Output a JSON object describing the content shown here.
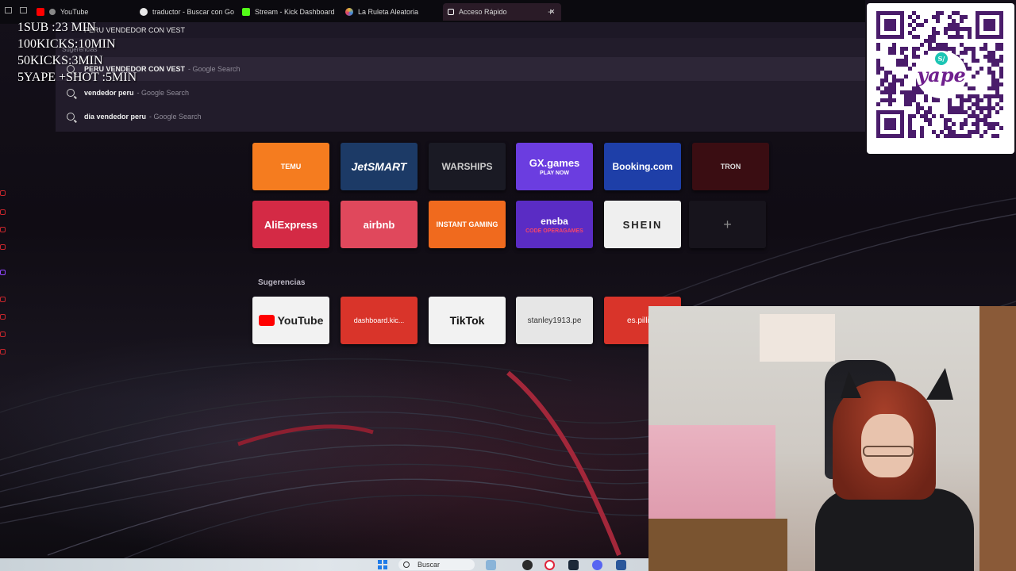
{
  "browser": {
    "tabs": [
      {
        "title": "YouTube",
        "icon": "youtube-icon",
        "color": "#ff0000"
      },
      {
        "title": "traductor - Buscar con Go",
        "icon": "google-icon",
        "color": "#e8e8e8"
      },
      {
        "title": "Stream - Kick Dashboard",
        "icon": "kick-icon",
        "color": "#53fc18"
      },
      {
        "title": "La Ruleta Aleatoria",
        "icon": "wheel-icon",
        "color": "#e0b83a"
      },
      {
        "title": "Acceso Rápido",
        "icon": "grid-icon",
        "color": "#ffffff"
      }
    ],
    "address_value": "PERU VENDEDOR CON VEST",
    "suggestions_heading": "Sugerencias",
    "suggestions": [
      {
        "text": "PERU VENDEDOR CON VEST",
        "engine": "- Google Search"
      },
      {
        "text": "vendedor peru",
        "engine": "- Google Search"
      },
      {
        "text": "dia vendedor peru",
        "engine": "- Google Search"
      }
    ]
  },
  "overlay": {
    "lines": [
      "1SUB :23 MIN",
      "100KICKS:10MIN",
      "50KICKS:3MIN",
      "5YAPE +SHOT :5MIN"
    ]
  },
  "speed_dial": {
    "tiles": [
      {
        "label": "TEMU",
        "bg": "#f57c1f"
      },
      {
        "label": "JetSMART",
        "bg": "#1c3a66"
      },
      {
        "label": "WARSHIPS",
        "bg": "#1a1a24"
      },
      {
        "label": "GX.games",
        "sub": "PLAY NOW",
        "bg": "#6b3de0"
      },
      {
        "label": "Booking.com",
        "bg": "#1e3fa8"
      },
      {
        "label": "TRON",
        "bg": "#3a0d12"
      },
      {
        "label": "AliExpress",
        "bg": "#d42a45"
      },
      {
        "label": "airbnb",
        "bg": "#e0485c"
      },
      {
        "label": "INSTANT GAMING",
        "bg": "#f06a1e"
      },
      {
        "label": "eneba",
        "sub": "CODE OPERAGAMES",
        "bg": "#5a2cc4"
      },
      {
        "label": "SHEIN",
        "bg": "#efefef"
      },
      {
        "label": "+",
        "bg": "#17141c"
      }
    ],
    "suggestions_label": "Sugerencias",
    "suggested": [
      {
        "label": "YouTube",
        "bg": "#f2f2f2"
      },
      {
        "label": "dashboard.kic...",
        "bg": "#d9342a"
      },
      {
        "label": "TikTok",
        "bg": "#f2f2f2"
      },
      {
        "label": "stanley1913.pe",
        "bg": "#e6e6e6"
      },
      {
        "label": "es.pilliap",
        "bg": "#d9342a"
      }
    ]
  },
  "taskbar": {
    "search_label": "Buscar"
  },
  "qr": {
    "brand": "yape",
    "badge": "S/"
  }
}
